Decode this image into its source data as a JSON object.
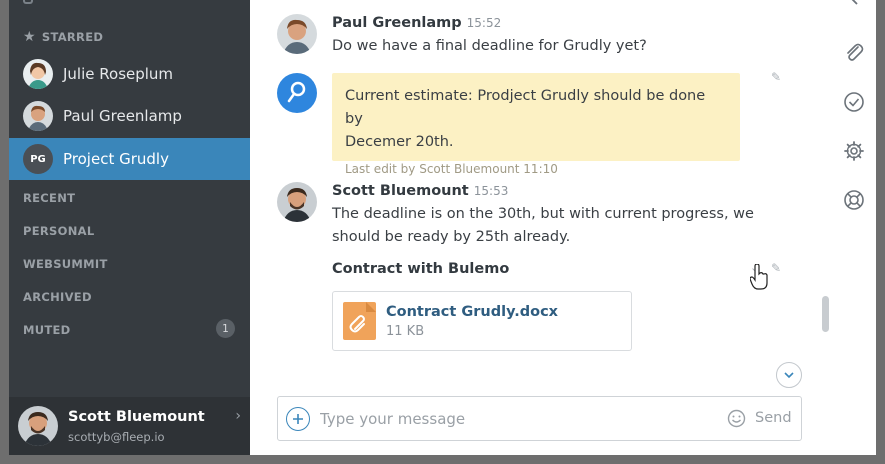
{
  "sidebar": {
    "starred_label": "STARRED",
    "starred": [
      {
        "name": "Julie Roseplum"
      },
      {
        "name": "Paul Greenlamp"
      },
      {
        "name": "Project Grudly",
        "initials": "PG",
        "active": true
      }
    ],
    "sections": [
      {
        "label": "RECENT"
      },
      {
        "label": "PERSONAL"
      },
      {
        "label": "WEBSUMMIT"
      },
      {
        "label": "ARCHIVED"
      },
      {
        "label": "MUTED",
        "badge": "1"
      }
    ],
    "profile": {
      "name": "Scott Bluemount",
      "email": "scottyb@fleep.io"
    }
  },
  "messages": [
    {
      "sender": "Paul Greenlamp",
      "time": "15:52",
      "text": "Do we have a final deadline for Grudly yet?"
    },
    {
      "pinned_line1": "Current estimate: Prodject Grudly should be done by",
      "pinned_line2": "Decemer 20th.",
      "edit_note": "Last edit by Scott Bluemount 11:10"
    },
    {
      "sender": "Scott Bluemount",
      "time": "15:53",
      "text_line1": "The deadline is on the 30th, but with current progress, we",
      "text_line2": "should be ready by 25th already.",
      "subheading": "Contract with Bulemo"
    }
  ],
  "file": {
    "name": "Contract Grudly.docx",
    "size": "11 KB"
  },
  "composer": {
    "placeholder": "Type your message",
    "send_label": "Send"
  },
  "colors": {
    "accent": "#3a86ba",
    "sidebar_bg": "#363b40",
    "pinned_bg": "#fcf1c4",
    "file_icon": "#f0a35a"
  },
  "icons": {
    "rail": [
      "chevron-right-icon",
      "paperclip-icon",
      "check-circle-icon",
      "gear-icon",
      "lifebuoy-icon"
    ]
  }
}
